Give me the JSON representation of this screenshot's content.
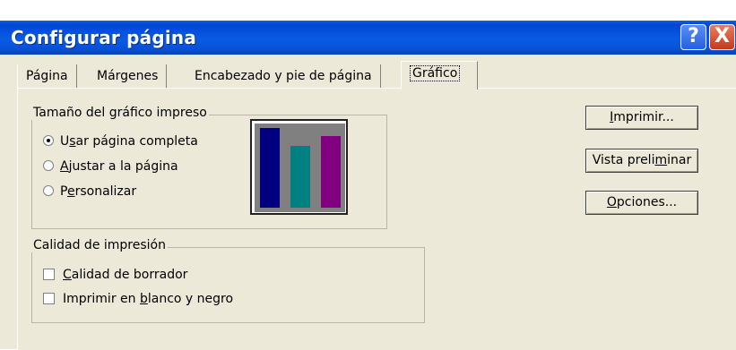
{
  "window": {
    "title": "Configurar página"
  },
  "title_buttons": {
    "help": "?",
    "close": "X"
  },
  "tabs": [
    {
      "label": "Página"
    },
    {
      "label": "Márgenes"
    },
    {
      "label": "Encabezado y pie de página"
    },
    {
      "label": "Gráfico",
      "active": true
    }
  ],
  "size_group": {
    "legend": "Tamaño del gráfico impreso",
    "options": [
      {
        "pre": "U",
        "key": "s",
        "post": "ar página completa",
        "selected": true
      },
      {
        "pre": "",
        "key": "A",
        "post": "justar a la página",
        "selected": false
      },
      {
        "pre": "P",
        "key": "e",
        "post": "rsonalizar",
        "selected": false
      }
    ]
  },
  "preview_chart": {
    "icon": "bar-chart-preview-icon",
    "bars": [
      {
        "value": 1.0,
        "color": "#000080"
      },
      {
        "value": 0.77,
        "color": "#008080"
      },
      {
        "value": 0.9,
        "color": "#800080"
      }
    ],
    "frame_color": "#808080"
  },
  "quality_group": {
    "legend": "Calidad de impresión",
    "options": [
      {
        "pre": "",
        "key": "C",
        "post": "alidad de borrador",
        "checked": false
      },
      {
        "pre": "Imprimir en ",
        "key": "b",
        "post": "lanco y negro",
        "checked": false
      }
    ]
  },
  "buttons": {
    "print": {
      "pre": "",
      "key": "I",
      "post": "mprimir..."
    },
    "preview": {
      "pre": "Vista preli",
      "key": "m",
      "post": "inar"
    },
    "options": {
      "pre": "",
      "key": "O",
      "post": "pciones..."
    }
  },
  "colors": {
    "title_bar": "#0a5be4",
    "dialog_bg": "#ece9d8"
  }
}
